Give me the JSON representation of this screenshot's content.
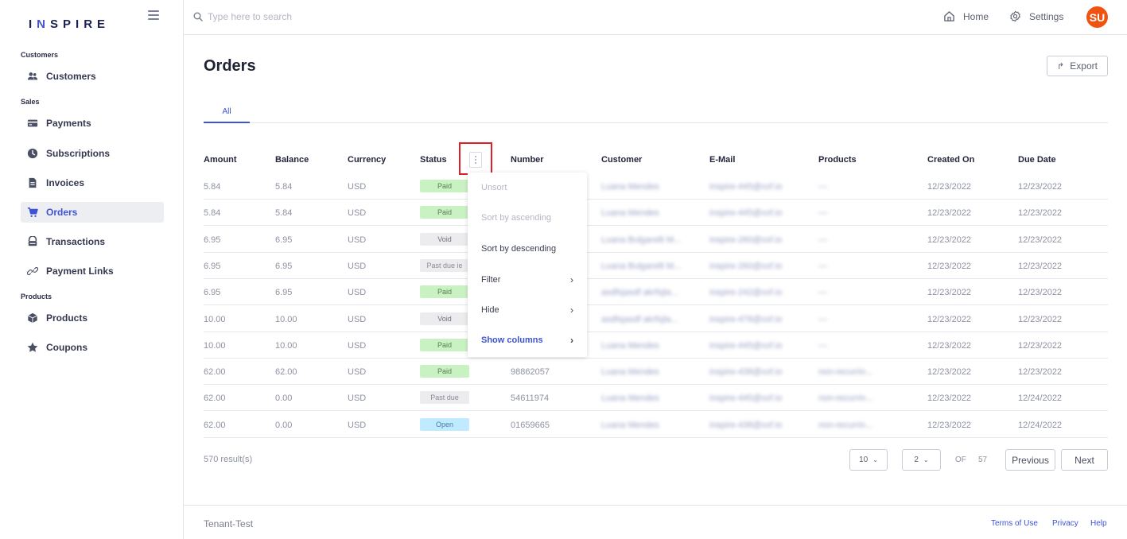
{
  "brand": {
    "name_pre": "I",
    "name_hl": "N",
    "name_post": "SPIRE"
  },
  "sidebar": {
    "sections": [
      {
        "label": "Customers"
      },
      {
        "label": "Sales"
      },
      {
        "label": "Products"
      }
    ],
    "items": [
      {
        "label": "Customers",
        "icon": "users-icon"
      },
      {
        "label": "Payments",
        "icon": "card-icon"
      },
      {
        "label": "Subscriptions",
        "icon": "clock-icon"
      },
      {
        "label": "Invoices",
        "icon": "document-icon"
      },
      {
        "label": "Orders",
        "icon": "cart-icon",
        "active": true
      },
      {
        "label": "Transactions",
        "icon": "wallet-icon"
      },
      {
        "label": "Payment Links",
        "icon": "link-icon"
      },
      {
        "label": "Products",
        "icon": "box-icon"
      },
      {
        "label": "Coupons",
        "icon": "star-icon"
      }
    ]
  },
  "search": {
    "placeholder": "Type here to search"
  },
  "topnav": {
    "home": "Home",
    "settings": "Settings",
    "avatar_initials": "SU"
  },
  "page": {
    "title": "Orders",
    "export_label": "Export",
    "tab_all": "All"
  },
  "table": {
    "headers": [
      "Amount",
      "Balance",
      "Currency",
      "Status",
      "Number",
      "Customer",
      "E-Mail",
      "Products",
      "Created On",
      "Due Date"
    ],
    "rows": [
      {
        "amount": "5.84",
        "balance": "5.84",
        "currency": "USD",
        "status": "Paid",
        "number": "",
        "customer": "Luana Mendes",
        "email": "inspire-445@xxf.io",
        "products": "—",
        "created": "12/23/2022",
        "due": "12/23/2022"
      },
      {
        "amount": "5.84",
        "balance": "5.84",
        "currency": "USD",
        "status": "Paid",
        "number": "",
        "customer": "Luana Mendes",
        "email": "inspire-445@xxf.io",
        "products": "—",
        "created": "12/23/2022",
        "due": "12/23/2022"
      },
      {
        "amount": "6.95",
        "balance": "6.95",
        "currency": "USD",
        "status": "Void",
        "number": "",
        "customer": "Luana Bulgarelli M...",
        "email": "inspire-260@xxf.io",
        "products": "—",
        "created": "12/23/2022",
        "due": "12/23/2022"
      },
      {
        "amount": "6.95",
        "balance": "6.95",
        "currency": "USD",
        "status": "Past due ie",
        "number": "",
        "customer": "Luana Bulgarelli M...",
        "email": "inspire-260@xxf.io",
        "products": "—",
        "created": "12/23/2022",
        "due": "12/23/2022"
      },
      {
        "amount": "6.95",
        "balance": "6.95",
        "currency": "USD",
        "status": "Paid",
        "number": "",
        "customer": "asdfsjasdf akrfsjla...",
        "email": "inspire-242@xxf.io",
        "products": "—",
        "created": "12/23/2022",
        "due": "12/23/2022"
      },
      {
        "amount": "10.00",
        "balance": "10.00",
        "currency": "USD",
        "status": "Void",
        "number": "",
        "customer": "asdfsjasdf akrfsjla...",
        "email": "inspire-478@xxf.io",
        "products": "—",
        "created": "12/23/2022",
        "due": "12/23/2022"
      },
      {
        "amount": "10.00",
        "balance": "10.00",
        "currency": "USD",
        "status": "Paid",
        "number": "",
        "customer": "Luana Mendes",
        "email": "inspire-445@xxf.io",
        "products": "—",
        "created": "12/23/2022",
        "due": "12/23/2022"
      },
      {
        "amount": "62.00",
        "balance": "62.00",
        "currency": "USD",
        "status": "Paid",
        "number": "98862057",
        "customer": "Luana Mendes",
        "email": "inspire-438@xxf.io",
        "products": "non-recurrin...",
        "created": "12/23/2022",
        "due": "12/23/2022"
      },
      {
        "amount": "62.00",
        "balance": "0.00",
        "currency": "USD",
        "status": "Past due",
        "number": "54611974",
        "customer": "Luana Mendes",
        "email": "inspire-445@xxf.io",
        "products": "non-recurrin...",
        "created": "12/23/2022",
        "due": "12/24/2022"
      },
      {
        "amount": "62.00",
        "balance": "0.00",
        "currency": "USD",
        "status": "Open",
        "number": "01659665",
        "customer": "Luana Mendes",
        "email": "inspire-438@xxf.io",
        "products": "non-recurrin...",
        "created": "12/23/2022",
        "due": "12/24/2022"
      }
    ]
  },
  "column_menu": {
    "items": [
      {
        "label": "Unsort",
        "state": "disabled"
      },
      {
        "label": "Sort by ascending",
        "state": "disabled"
      },
      {
        "label": "Sort by descending",
        "state": "normal"
      },
      {
        "label": "Filter",
        "state": "normal",
        "submenu": true
      },
      {
        "label": "Hide",
        "state": "normal",
        "submenu": true
      },
      {
        "label": "Show columns",
        "state": "accent",
        "submenu": true
      }
    ]
  },
  "pagination": {
    "results": "570 result(s)",
    "page_size": "10",
    "current_page": "2",
    "of_label": "OF",
    "total_pages": "57",
    "previous": "Previous",
    "next": "Next"
  },
  "footer": {
    "tenant": "Tenant-Test",
    "terms": "Terms of Use",
    "privacy": "Privacy",
    "help": "Help"
  },
  "colors": {
    "accent": "#3d52d5",
    "avatar": "#f0530f",
    "highlight": "#e01e26",
    "paid": "#c9f2c3",
    "open": "#bfeaff"
  }
}
